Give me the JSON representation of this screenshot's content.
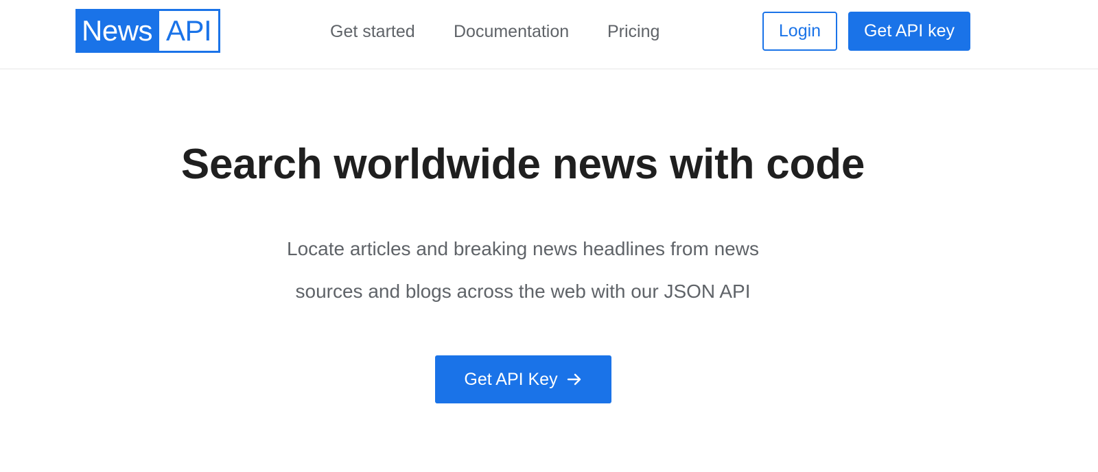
{
  "header": {
    "logo": {
      "left": "News",
      "right": "API"
    },
    "nav": [
      {
        "label": "Get started"
      },
      {
        "label": "Documentation"
      },
      {
        "label": "Pricing"
      }
    ],
    "login_label": "Login",
    "get_key_label": "Get API key"
  },
  "hero": {
    "title": "Search worldwide news with code",
    "subtitle_line1": "Locate articles and breaking news headlines from news",
    "subtitle_line2": "sources and blogs across the web with our JSON API",
    "cta_label": "Get API Key",
    "cta_icon": "arrow-right-icon"
  },
  "colors": {
    "accent": "#1a73e8",
    "text_dark": "#1f1f1f",
    "text_muted": "#5f6368"
  }
}
